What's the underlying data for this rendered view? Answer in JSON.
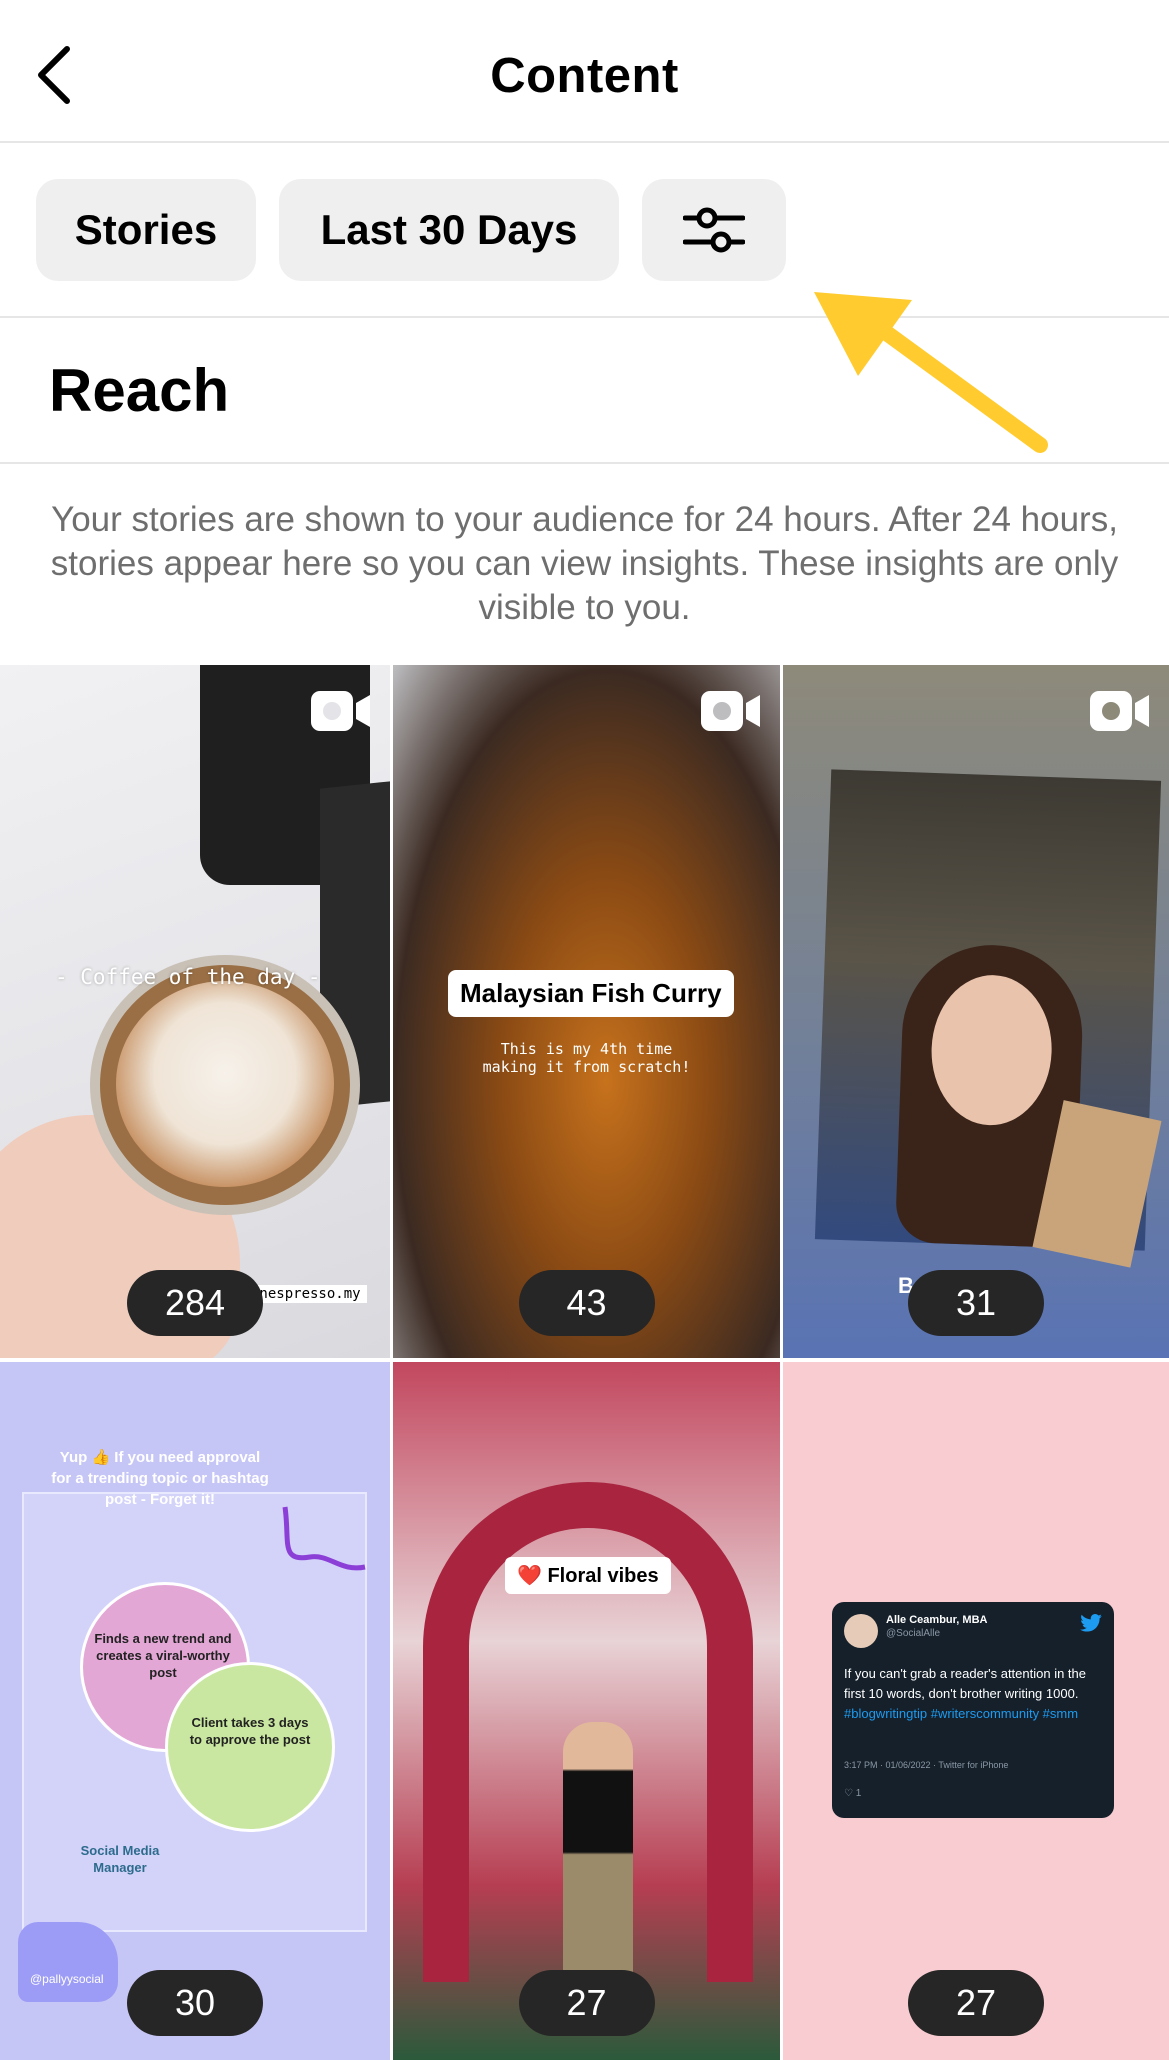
{
  "header": {
    "title": "Content",
    "back_icon": "chevron-left-icon"
  },
  "filters": {
    "type_label": "Stories",
    "range_label": "Last 30 Days",
    "settings_icon": "sliders-icon"
  },
  "annotation": {
    "arrow_color": "#FFCB2F"
  },
  "section": {
    "title": "Reach",
    "info": "Your stories are shown to your audience for 24 hours. After 24 hours, stories appear here so you can view insights. These insights are only visible to you."
  },
  "stories": [
    {
      "count": "284",
      "caption": "- Coffee of the day -",
      "mention": "@nespresso.my",
      "video_icon": "video-icon"
    },
    {
      "count": "43",
      "sticker": "Malaysian Fish Curry",
      "caption": "This is my 4th time\nmaking it from scratch!",
      "video_icon": "video-icon"
    },
    {
      "count": "31",
      "caption": "B       r",
      "video_icon": "video-icon"
    },
    {
      "count": "30",
      "heading": "Yup 👍 If you need approval for a trending topic or hashtag post - Forget it!",
      "circle_a": "Finds a new trend and creates a viral-worthy post",
      "circle_b": "Client takes 3 days to approve the post",
      "role": "Social Media Manager",
      "handle": "@pallyysocial"
    },
    {
      "count": "27",
      "sticker": "❤️ Floral vibes"
    },
    {
      "count": "27",
      "tweet": {
        "name": "Alle Ceambur, MBA",
        "handle": "@SocialAlle",
        "text": "If you can't grab a reader's attention in the first 10 words, don't brother writing 1000.",
        "tags": "#blogwritingtip #writerscommunity #smm",
        "meta": "3:17 PM · 01/06/2022 · Twitter for iPhone",
        "likes": "♡ 1"
      }
    }
  ]
}
